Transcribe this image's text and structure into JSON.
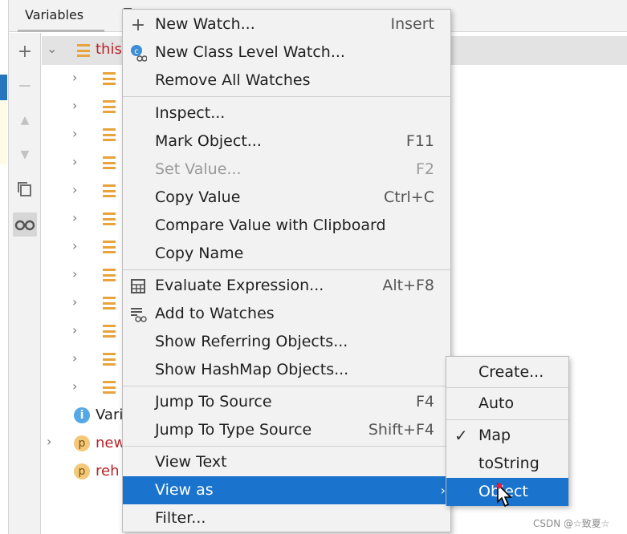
{
  "panel": {
    "tab_label": "Variables",
    "rows": [
      {
        "text": "this",
        "color": "#b8242a"
      },
      {
        "text": "Vari",
        "color": "#1f1f1f"
      },
      {
        "text": "new",
        "color": "#b8242a"
      },
      {
        "text": "reh",
        "color": "#b8242a"
      }
    ]
  },
  "toolbar": {
    "add": "+",
    "remove": "−",
    "up": "▲",
    "down": "▼"
  },
  "menu": {
    "items": [
      {
        "label": "New Watch...",
        "shortcut": "Insert"
      },
      {
        "label": "New Class Level Watch...",
        "shortcut": ""
      },
      {
        "label": "Remove All Watches",
        "shortcut": ""
      },
      {
        "label": "Inspect...",
        "shortcut": ""
      },
      {
        "label": "Mark Object...",
        "shortcut": "F11"
      },
      {
        "label": "Set Value...",
        "shortcut": "F2"
      },
      {
        "label": "Copy Value",
        "shortcut": "Ctrl+C"
      },
      {
        "label": "Compare Value with Clipboard",
        "shortcut": ""
      },
      {
        "label": "Copy Name",
        "shortcut": ""
      },
      {
        "label": "Evaluate Expression...",
        "shortcut": "Alt+F8"
      },
      {
        "label": "Add to Watches",
        "shortcut": ""
      },
      {
        "label": "Show Referring Objects...",
        "shortcut": ""
      },
      {
        "label": "Show HashMap Objects...",
        "shortcut": ""
      },
      {
        "label": "Jump To Source",
        "shortcut": "F4"
      },
      {
        "label": "Jump To Type Source",
        "shortcut": "Shift+F4"
      },
      {
        "label": "View Text",
        "shortcut": ""
      },
      {
        "label": "View as",
        "shortcut": ""
      },
      {
        "label": "Filter...",
        "shortcut": ""
      }
    ],
    "plus_glyph": "+",
    "class_glyph": "c",
    "submenu_arrow": "›"
  },
  "submenu": {
    "items": [
      {
        "label": "Create..."
      },
      {
        "label": "Auto"
      },
      {
        "label": "Map",
        "checked": true
      },
      {
        "label": "toString"
      },
      {
        "label": "Object"
      }
    ],
    "check_glyph": "✓"
  },
  "watermark": "CSDN @☆致夏☆",
  "colors": {
    "highlight": "#1a73cc",
    "menu_bg": "#f2f2f2",
    "field_icon": "#e8a33c",
    "static_field_text": "#b8242a"
  }
}
